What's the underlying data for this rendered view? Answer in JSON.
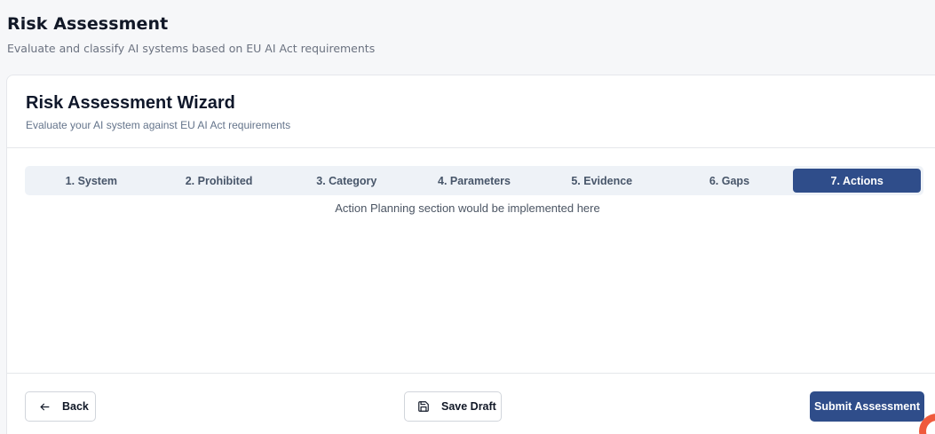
{
  "page": {
    "title": "Risk Assessment",
    "subtitle": "Evaluate and classify AI systems based on EU AI Act requirements"
  },
  "wizard": {
    "title": "Risk Assessment Wizard",
    "subtitle": "Evaluate your AI system against EU AI Act requirements",
    "tabs": [
      {
        "label": "1. System",
        "active": false
      },
      {
        "label": "2. Prohibited",
        "active": false
      },
      {
        "label": "3. Category",
        "active": false
      },
      {
        "label": "4. Parameters",
        "active": false
      },
      {
        "label": "5. Evidence",
        "active": false
      },
      {
        "label": "6. Gaps",
        "active": false
      },
      {
        "label": "7. Actions",
        "active": true
      }
    ],
    "content_message": "Action Planning section would be implemented here"
  },
  "footer": {
    "back_label": "Back",
    "save_label": "Save Draft",
    "submit_label": "Submit Assessment"
  },
  "colors": {
    "accent": "#2f4d8a",
    "badge": "#ef5a3c"
  },
  "icons": {
    "back": "arrow-left-icon",
    "save": "save-icon"
  }
}
